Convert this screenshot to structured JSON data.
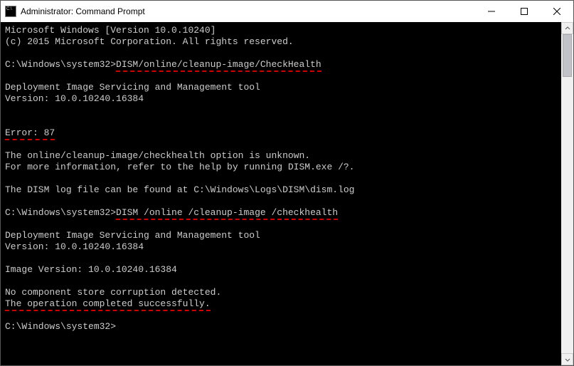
{
  "titlebar": {
    "title": "Administrator: Command Prompt"
  },
  "lines": {
    "l0": "Microsoft Windows [Version 10.0.10240]",
    "l1": "(c) 2015 Microsoft Corporation. All rights reserved.",
    "prompt1": "C:\\Windows\\system32>",
    "cmd1": "DISM/online/cleanup-image/CheckHealth",
    "l4": "Deployment Image Servicing and Management tool",
    "l5": "Version: 10.0.10240.16384",
    "err": "Error: 87",
    "l7": "The online/cleanup-image/checkhealth option is unknown.",
    "l8": "For more information, refer to the help by running DISM.exe /?.",
    "l9": "The DISM log file can be found at C:\\Windows\\Logs\\DISM\\dism.log",
    "prompt2": "C:\\Windows\\system32>",
    "cmd2": "DISM /online /cleanup-image /checkhealth",
    "l11": "Deployment Image Servicing and Management tool",
    "l12": "Version: 10.0.10240.16384",
    "l13": "Image Version: 10.0.10240.16384",
    "l14": "No component store corruption detected.",
    "l15": "The operation completed successfully.",
    "prompt3": "C:\\Windows\\system32>"
  }
}
